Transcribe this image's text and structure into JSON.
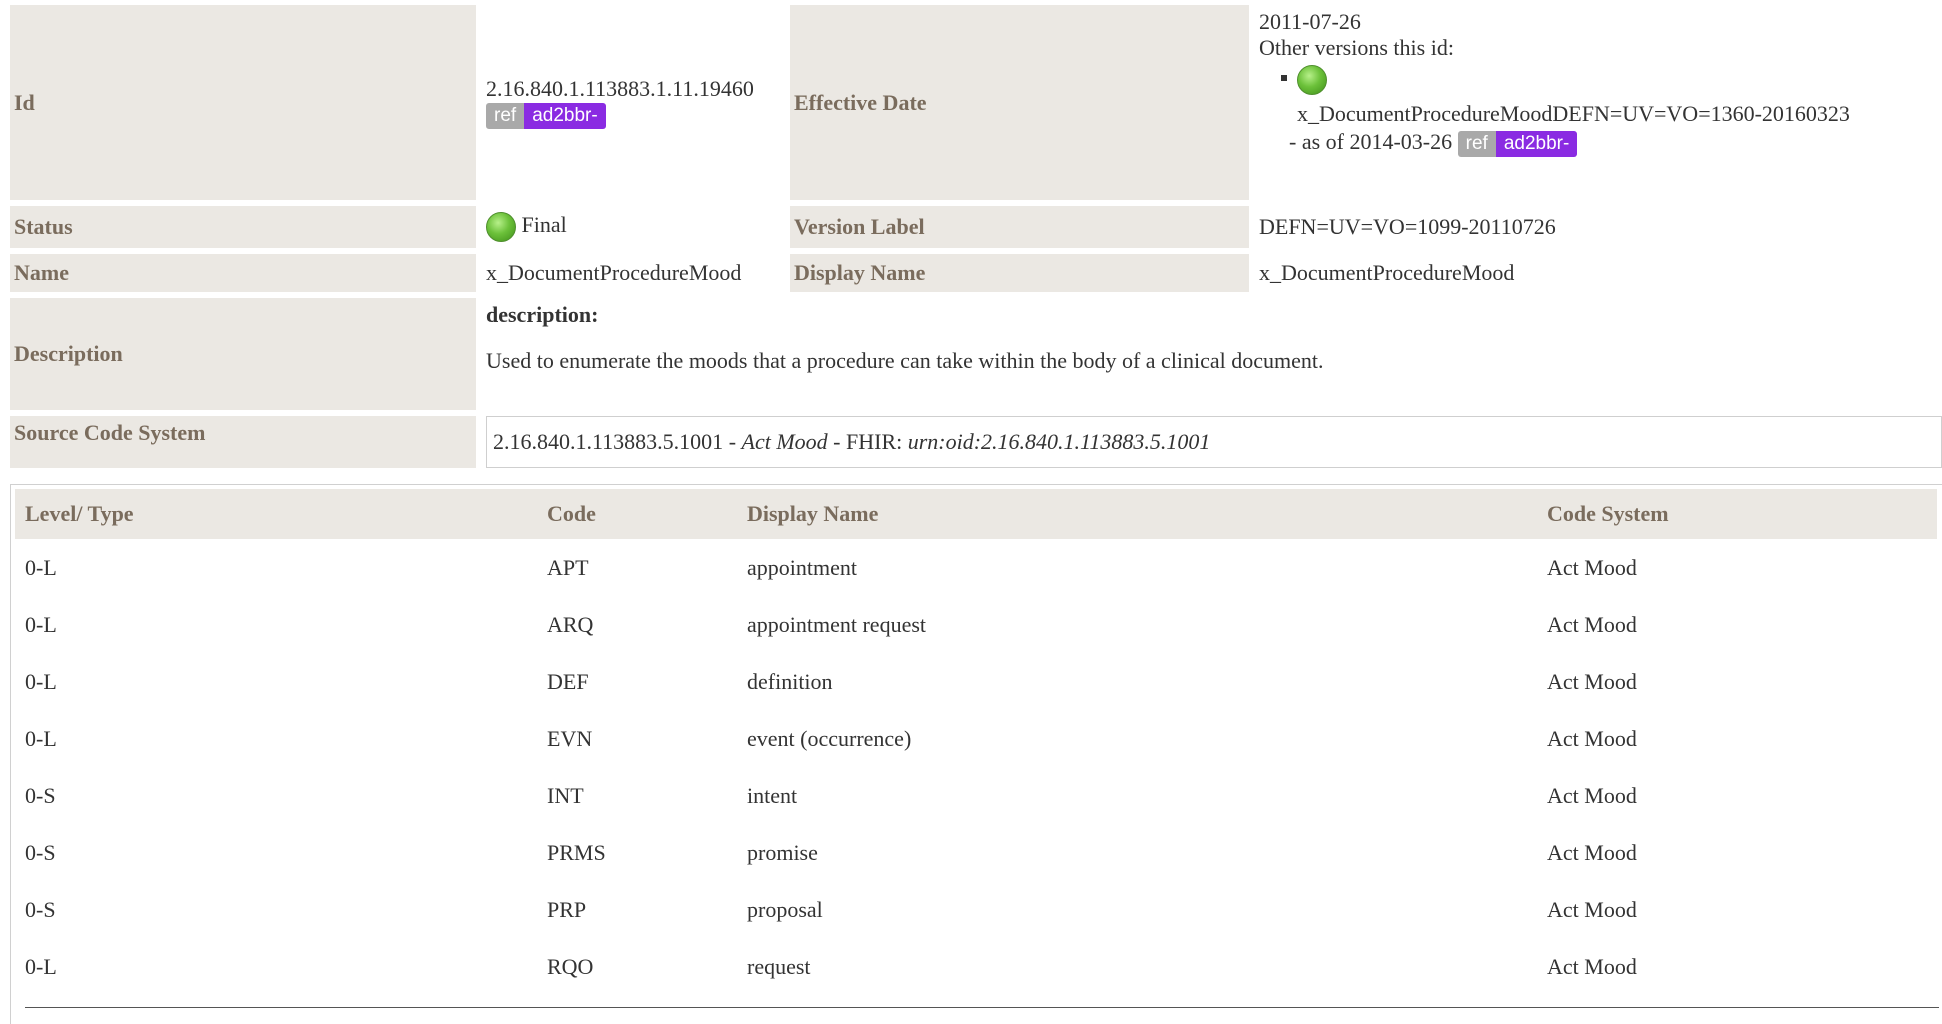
{
  "meta": {
    "id_label": "Id",
    "id_value": "2.16.840.1.113883.1.11.19460",
    "id_badge_ref": "ref",
    "id_badge_repo": "ad2bbr-",
    "effective_date_label": "Effective Date",
    "effective_date_value": "2011-07-26",
    "other_versions_label": "Other versions this id:",
    "other_version_name": "x_DocumentProcedureMoodDEFN=UV=VO=1360-20160323",
    "other_version_asof": "- as of 2014-03-26",
    "other_version_badge_ref": "ref",
    "other_version_badge_repo": "ad2bbr-",
    "status_label": "Status",
    "status_value": "Final",
    "version_label_label": "Version Label",
    "version_label_value": "DEFN=UV=VO=1099-20110726",
    "name_label": "Name",
    "name_value": "x_DocumentProcedureMood",
    "display_name_label": "Display Name",
    "display_name_value": "x_DocumentProcedureMood",
    "description_label": "Description",
    "description_heading": "description:",
    "description_text": "Used to enumerate the moods that a procedure can take within the body of a clinical document.",
    "source_label": "Source Code System",
    "source_oid": "2.16.840.1.113883.5.1001",
    "source_sep1": " - ",
    "source_name": "Act Mood",
    "source_sep2": " - FHIR: ",
    "source_uri": "urn:oid:2.16.840.1.113883.5.1001"
  },
  "concepts": {
    "headers": [
      "Level/ Type",
      "Code",
      "Display Name",
      "Code System"
    ],
    "rows": [
      {
        "level": "0-L",
        "code": "APT",
        "display": "appointment",
        "system": "Act Mood"
      },
      {
        "level": "0-L",
        "code": "ARQ",
        "display": "appointment request",
        "system": "Act Mood"
      },
      {
        "level": "0-L",
        "code": "DEF",
        "display": "definition",
        "system": "Act Mood"
      },
      {
        "level": "0-L",
        "code": "EVN",
        "display": "event (occurrence)",
        "system": "Act Mood"
      },
      {
        "level": "0-S",
        "code": "INT",
        "display": "intent",
        "system": "Act Mood"
      },
      {
        "level": "0-S",
        "code": "PRMS",
        "display": "promise",
        "system": "Act Mood"
      },
      {
        "level": "0-S",
        "code": "PRP",
        "display": "proposal",
        "system": "Act Mood"
      },
      {
        "level": "0-L",
        "code": "RQO",
        "display": "request",
        "system": "Act Mood"
      }
    ]
  },
  "colors": {
    "label_bg": "#ebe8e3",
    "label_text": "#7a6c5d",
    "badge_ref_bg": "#a9a9a9",
    "badge_repo_bg": "#8a2be2",
    "status_dot": "#6cc13a"
  }
}
